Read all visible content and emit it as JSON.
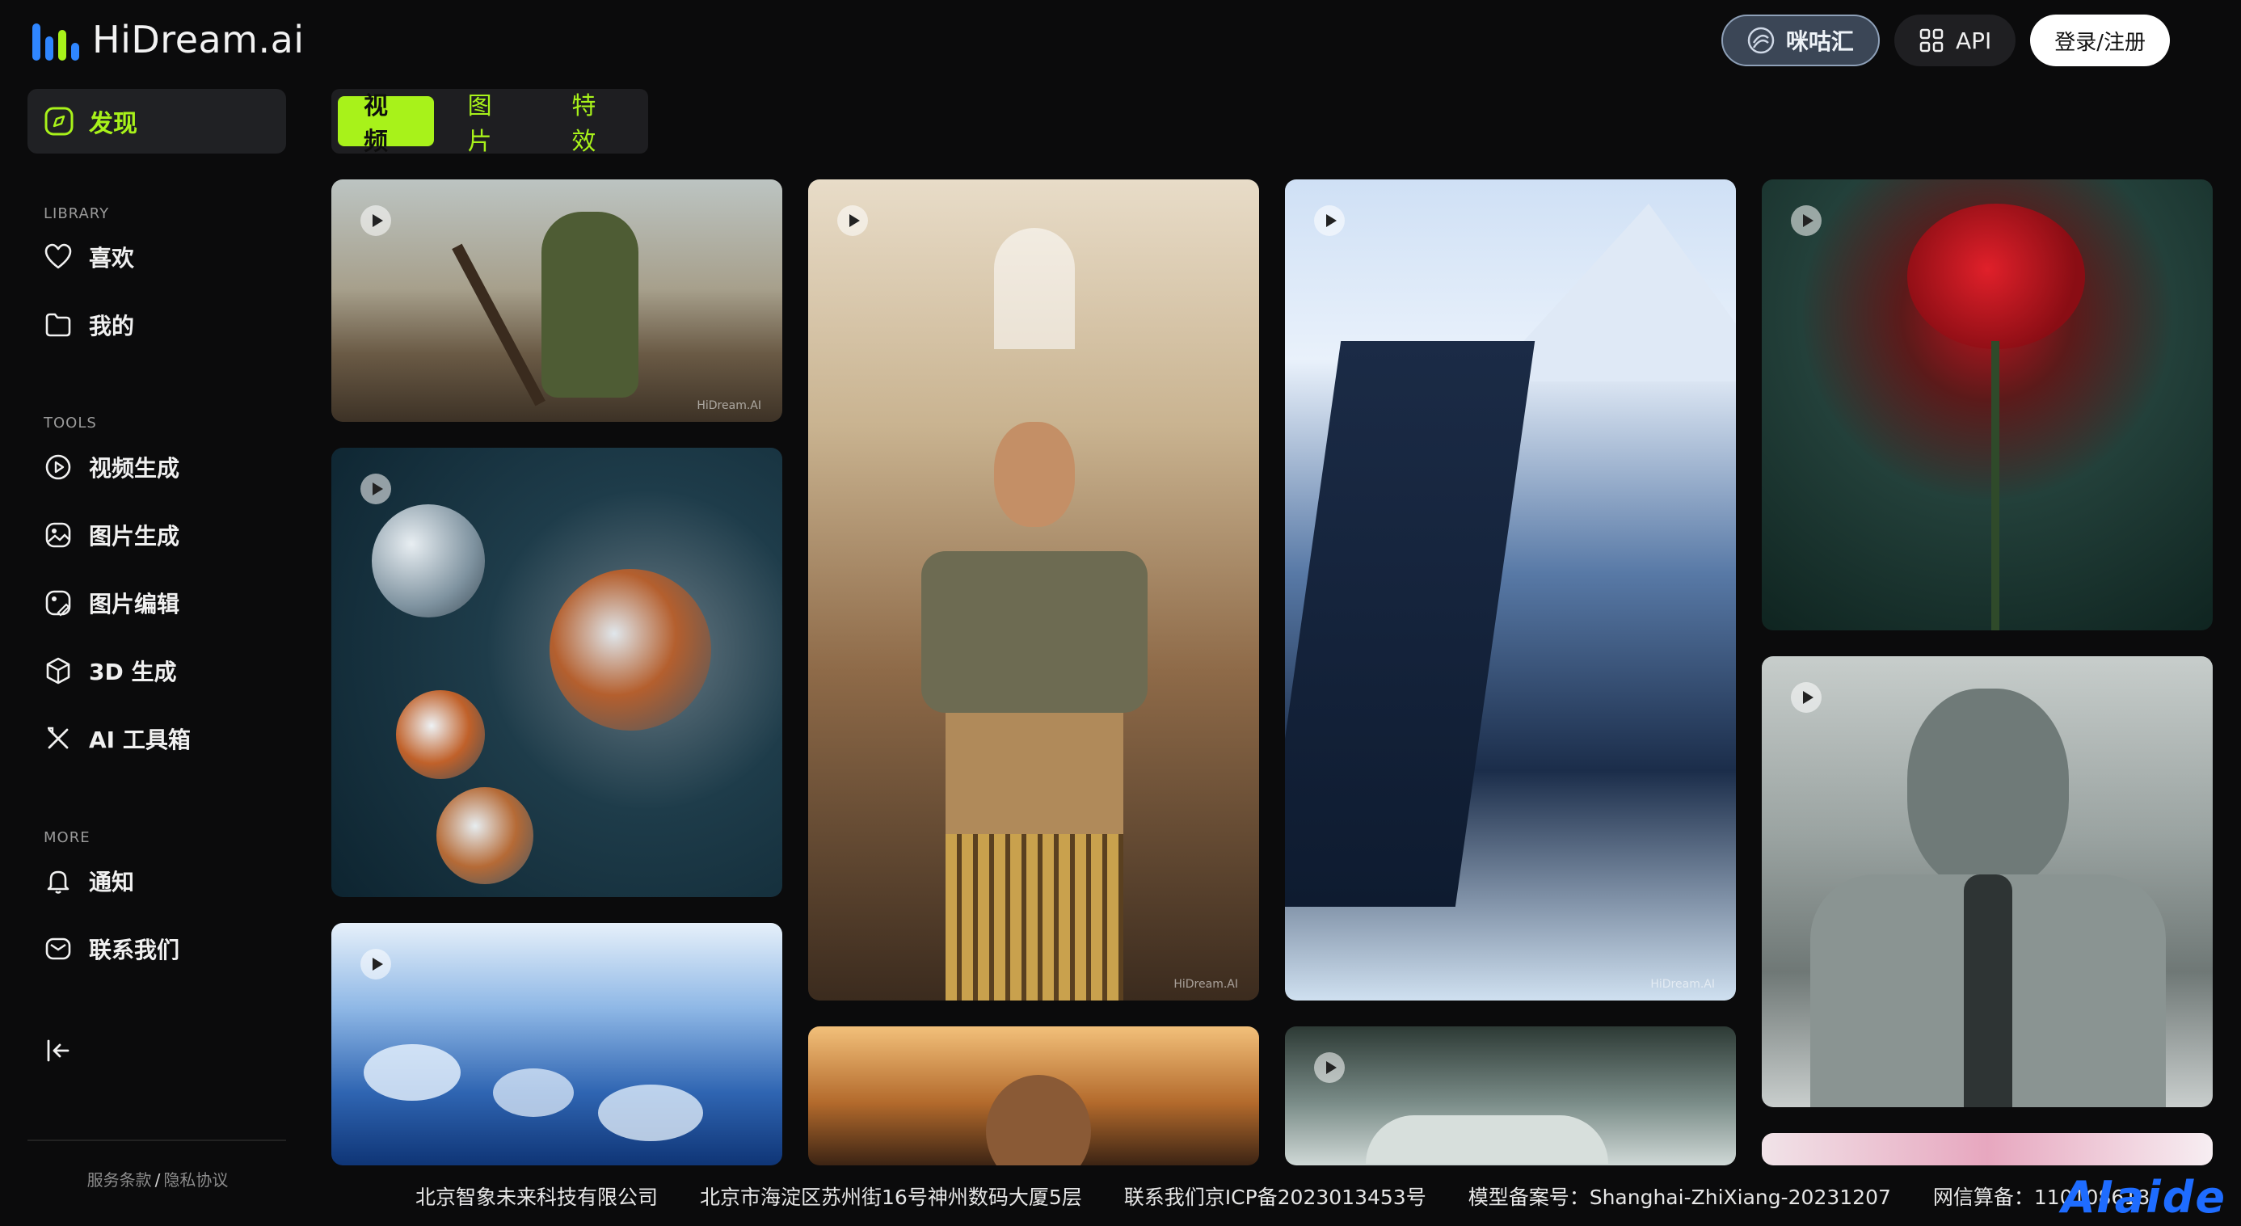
{
  "brand": {
    "name": "HiDream.ai",
    "colors": {
      "accent": "#a8f21a",
      "logo_blue": "#2f86ff",
      "logo_green": "#a8f21a"
    }
  },
  "header": {
    "migu_label": "咪咕汇",
    "api_label": "API",
    "login_label": "登录/注册"
  },
  "sidebar": {
    "discover": {
      "label": "发现",
      "icon": "compass-icon"
    },
    "sections": [
      {
        "label": "LIBRARY",
        "items": [
          {
            "label": "喜欢",
            "icon": "heart-icon"
          },
          {
            "label": "我的",
            "icon": "folder-icon"
          }
        ]
      },
      {
        "label": "TOOLS",
        "items": [
          {
            "label": "视频生成",
            "icon": "video-play-icon"
          },
          {
            "label": "图片生成",
            "icon": "image-generate-icon"
          },
          {
            "label": "图片编辑",
            "icon": "image-edit-icon"
          },
          {
            "label": "3D 生成",
            "icon": "cube-icon"
          },
          {
            "label": "AI 工具箱",
            "icon": "tools-icon"
          }
        ]
      },
      {
        "label": "MORE",
        "items": [
          {
            "label": "通知",
            "icon": "bell-icon"
          },
          {
            "label": "联系我们",
            "icon": "mail-icon"
          }
        ]
      }
    ],
    "legal": {
      "terms": "服务条款",
      "separator": "/",
      "privacy": "隐私协议"
    }
  },
  "tabs": [
    {
      "label": "视频",
      "active": true
    },
    {
      "label": "图片",
      "active": false
    },
    {
      "label": "特效",
      "active": false
    }
  ],
  "gallery": [
    {
      "subject": "orc warrior with axe",
      "video": true,
      "watermark": "HiDream.AI"
    },
    {
      "subject": "underwater glass spheres",
      "video": true
    },
    {
      "subject": "water pebbles",
      "video": true
    },
    {
      "subject": "young man in gold armor",
      "video": true,
      "watermark": "HiDream.AI"
    },
    {
      "subject": "sunset portrait",
      "video": false
    },
    {
      "subject": "snowy mountains",
      "video": true,
      "watermark": "HiDream.AI"
    },
    {
      "subject": "umbrella in mist",
      "video": true
    },
    {
      "subject": "red rose",
      "video": true
    },
    {
      "subject": "buddha statue",
      "video": true
    },
    {
      "subject": "pink blossoms",
      "video": false
    }
  ],
  "footer": {
    "company": "北京智象未来科技有限公司",
    "address": "北京市海淀区苏州街16号神州数码大厦5层",
    "icp": "联系我们京ICP备2023013453号",
    "model_record": "模型备案号：Shanghai-ZhiXiang-20231207",
    "net_record": "网信算备：110108618"
  },
  "overlay_watermark": "AIaide"
}
